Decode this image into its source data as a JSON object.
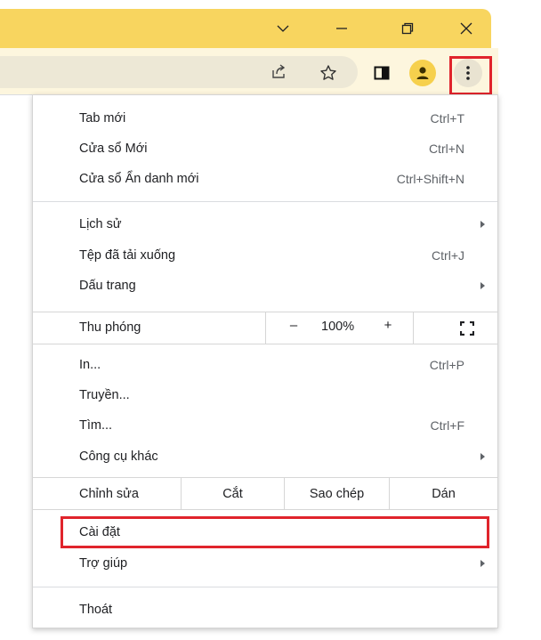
{
  "window": {
    "controls": [
      "chevron-down-icon",
      "minimize-icon",
      "restore-icon",
      "close-icon"
    ],
    "titlebar_color": "#f8d55f"
  },
  "toolbar": {
    "icons": [
      "share-icon",
      "star-icon",
      "side-panel-icon",
      "profile-avatar-icon",
      "kebab-menu-icon"
    ],
    "highlight_color": "#e0242c"
  },
  "menu": {
    "new_tab": {
      "label": "Tab mới",
      "shortcut": "Ctrl+T"
    },
    "new_window": {
      "label": "Cửa sổ Mới",
      "shortcut": "Ctrl+N"
    },
    "incognito": {
      "label": "Cửa sổ Ẩn danh mới",
      "shortcut": "Ctrl+Shift+N"
    },
    "history": {
      "label": "Lịch sử"
    },
    "downloads": {
      "label": "Tệp đã tải xuống",
      "shortcut": "Ctrl+J"
    },
    "bookmarks": {
      "label": "Dấu trang"
    },
    "zoom": {
      "label": "Thu phóng",
      "minus": "–",
      "value": "100%",
      "plus": "+"
    },
    "print": {
      "label": "In...",
      "shortcut": "Ctrl+P"
    },
    "cast": {
      "label": "Truyền..."
    },
    "find": {
      "label": "Tìm...",
      "shortcut": "Ctrl+F"
    },
    "more_tools": {
      "label": "Công cụ khác"
    },
    "edit": {
      "label": "Chỉnh sửa",
      "cut": "Cắt",
      "copy": "Sao chép",
      "paste": "Dán"
    },
    "settings": {
      "label": "Cài đặt"
    },
    "help": {
      "label": "Trợ giúp"
    },
    "exit": {
      "label": "Thoát"
    }
  }
}
